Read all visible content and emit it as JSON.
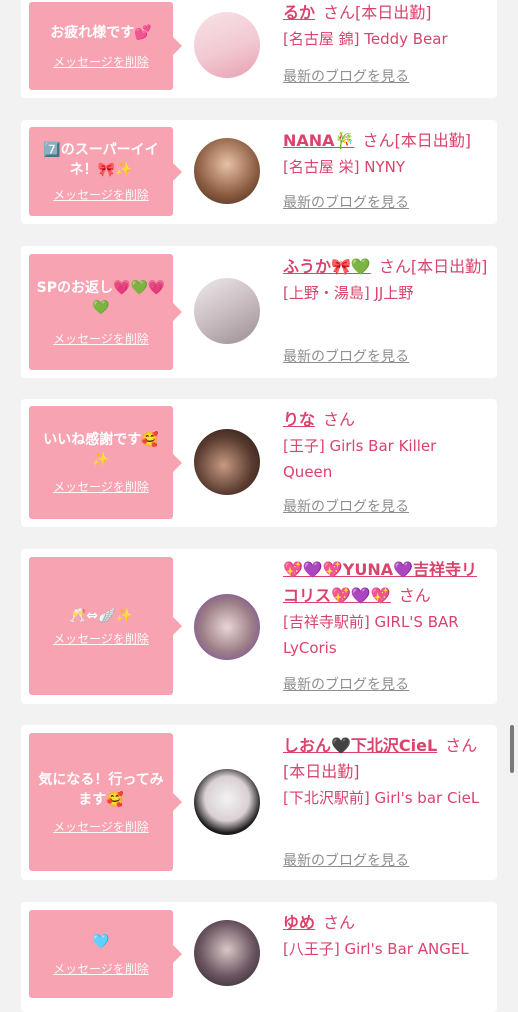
{
  "cards": [
    {
      "message": "お疲れ様です💕",
      "delete_label": "メッセージを削除",
      "name": "るか",
      "san": "さん[本日出勤]",
      "shop": "[名古屋 錦] Teddy Bear",
      "blog": "最新のブログを見る"
    },
    {
      "message": "7️⃣のスーパーイイネ！🎀✨",
      "delete_label": "メッセージを削除",
      "name": "NANA🎋",
      "san": "さん[本日出勤]",
      "shop": "[名古屋 栄] NYNY",
      "blog": "最新のブログを見る"
    },
    {
      "message": "SPのお返し💗💚💗💚",
      "delete_label": "メッセージを削除",
      "name": "ふうか🎀💚",
      "san": "さん[本日出勤]",
      "shop": "[上野・湯島] JJ上野",
      "blog": "最新のブログを見る"
    },
    {
      "message": "いいね感謝です🥰✨",
      "delete_label": "メッセージを削除",
      "name": "りな",
      "san": "さん",
      "shop": "[王子] Girls Bar Killer Queen",
      "blog": "最新のブログを見る"
    },
    {
      "message": "🥂⇔🪽✨",
      "delete_label": "メッセージを削除",
      "name": "💖💜💖YUNA💜吉祥寺リコリス💖💜💖",
      "san": "さん",
      "shop": "[吉祥寺駅前] GIRL'S BAR LyCoris",
      "blog": "最新のブログを見る"
    },
    {
      "message": "気になる！行ってみます🥰",
      "delete_label": "メッセージを削除",
      "name": "しおん🖤下北沢CieL",
      "san": "さん[本日出勤]",
      "shop": "[下北沢駅前] Girl's bar CieL",
      "blog": "最新のブログを見る"
    },
    {
      "message": "🩵",
      "delete_label": "メッセージを削除",
      "name": "ゆめ",
      "san": "さん",
      "shop": "[八王子] Girl's Bar ANGEL",
      "blog": "最新のブログを見る"
    }
  ],
  "colors": {
    "accent": "#d9436c",
    "bubble": "#f7a3b2",
    "link_gray": "#8e8e8e",
    "background": "#f2f2f2"
  }
}
